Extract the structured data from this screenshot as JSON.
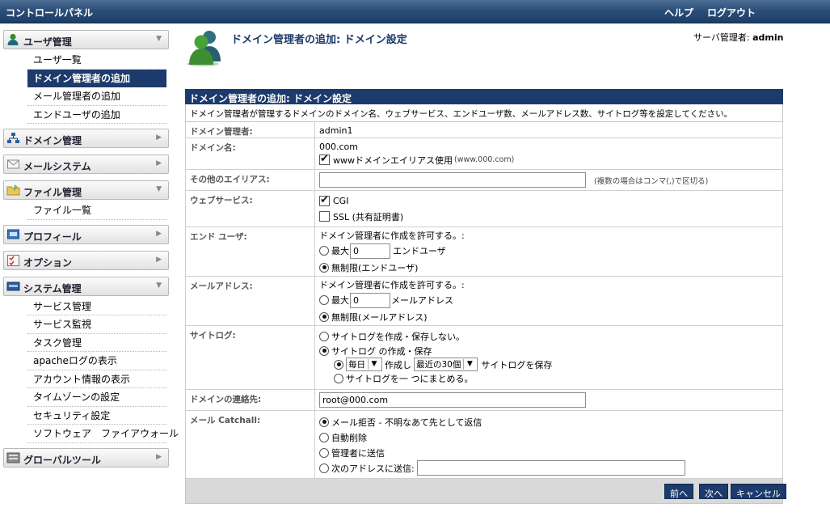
{
  "topbar": {
    "title": "コントロールパネル",
    "help": "ヘルプ",
    "logout": "ログアウト"
  },
  "sidebar": {
    "sections": [
      {
        "label": "ユーザ管理",
        "icon": "user-icon",
        "items": [
          "ユーザ一覧",
          "ドメイン管理者の追加",
          "メール管理者の追加",
          "エンドユーザの追加"
        ],
        "active": "ドメイン管理者の追加",
        "expanded": true
      },
      {
        "label": "ドメイン管理",
        "icon": "network-icon",
        "items": [],
        "expanded": false
      },
      {
        "label": "メールシステム",
        "icon": "mail-icon",
        "items": [],
        "expanded": false
      },
      {
        "label": "ファイル管理",
        "icon": "folder-icon",
        "items": [
          "ファイル一覧"
        ],
        "expanded": true
      },
      {
        "label": "プロフィール",
        "icon": "profile-icon",
        "items": [],
        "expanded": false
      },
      {
        "label": "オプション",
        "icon": "options-icon",
        "items": [],
        "expanded": false
      },
      {
        "label": "システム管理",
        "icon": "system-icon",
        "items": [
          "サービス管理",
          "サービス監視",
          "タスク管理",
          "apacheログの表示",
          "アカウント情報の表示",
          "タイムゾーンの設定",
          "セキュリティ設定",
          "ソフトウェア　ファイアウォール"
        ],
        "expanded": true
      },
      {
        "label": "グローバルツール",
        "icon": "tools-icon",
        "items": [],
        "expanded": false
      }
    ]
  },
  "header": {
    "title": "ドメイン管理者の追加: ドメイン設定",
    "admin_label": "サーバ管理者:",
    "admin_name": "admin"
  },
  "panel": {
    "title": "ドメイン管理者の追加: ドメイン設定",
    "description": "ドメイン管理者が管理するドメインのドメイン名、ウェブサービス、エンドユーザ数、メールアドレス数、サイトログ等を設定してください。",
    "rows": {
      "admin": {
        "label": "ドメイン管理者:",
        "value": "admin1"
      },
      "domain": {
        "label": "ドメイン名:",
        "value": "000.com",
        "www_label": "wwwドメインエイリアス使用",
        "www_example": "(www.000.com)",
        "www_checked": true
      },
      "alias": {
        "label": "その他のエイリアス:",
        "value": "",
        "hint": "(複数の場合はコンマ(,)で区切る)"
      },
      "web": {
        "label": "ウェブサービス:",
        "cgi": "CGI",
        "cgi_checked": true,
        "ssl": "SSL (共有証明書)",
        "ssl_checked": false
      },
      "endusers": {
        "label": "エンド ユーザ:",
        "prompt": "ドメイン管理者に作成を許可する。:",
        "max_label": "最大",
        "max_value": "0",
        "unit": "エンドユーザ",
        "unlimited": "無制限(エンドユーザ)",
        "selected": "unlimited"
      },
      "mail": {
        "label": "メールアドレス:",
        "prompt": "ドメイン管理者に作成を許可する。:",
        "max_label": "最大",
        "max_value": "0",
        "unit": "メールアドレス",
        "unlimited": "無制限(メールアドレス)",
        "selected": "unlimited"
      },
      "sitelog": {
        "label": "サイトログ:",
        "opt_none": "サイトログを作成・保存しない。",
        "opt_save": "サイトログ の作成・保存",
        "freq": "毎日",
        "created": "作成し",
        "keep": "最近の30個",
        "keep_suffix": "サイトログを保存",
        "opt_merge": "サイトログを一 つにまとめる。",
        "selected": "save"
      },
      "contact": {
        "label": "ドメインの連絡先:",
        "value": "root@000.com"
      },
      "catchall": {
        "label": "メール Catchall:",
        "opt_reject": "メール拒否 - 不明なあて先として返信",
        "opt_delete": "自動削除",
        "opt_admin": "管理者に送信",
        "opt_forward": "次のアドレスに送信:",
        "forward_value": "",
        "selected": "reject"
      }
    }
  },
  "buttons": {
    "prev": "前へ",
    "next": "次へ",
    "cancel": "キャンセル"
  },
  "colors": {
    "accent": "#1c3a6b",
    "topbar": "#2c4f7a"
  }
}
